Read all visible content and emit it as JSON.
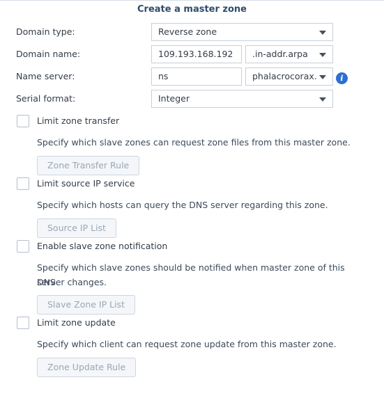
{
  "dialog": {
    "title": "Create a master zone"
  },
  "form": {
    "domain_type": {
      "label": "Domain type:",
      "value": "Reverse zone"
    },
    "domain_name": {
      "label": "Domain name:",
      "value": "109.193.168.192",
      "suffix": ".in-addr.arpa"
    },
    "name_server": {
      "label": "Name server:",
      "value": "ns",
      "domain": "phalacrocorax."
    },
    "serial_format": {
      "label": "Serial format:",
      "value": "Integer"
    }
  },
  "options": [
    {
      "label": "Limit zone transfer",
      "checked": false,
      "description": "Specify which slave zones can request zone files from this master zone.",
      "button": "Zone Transfer Rule"
    },
    {
      "label": "Limit source IP service",
      "checked": false,
      "description": "Specify which hosts can query the DNS server regarding this zone.",
      "button": "Source IP List"
    },
    {
      "label": "Enable slave zone notification",
      "checked": false,
      "description_line1": "Specify which slave zones should be notified when master zone of this DNS",
      "description_line2": "server changes.",
      "button": "Slave Zone IP List"
    },
    {
      "label": "Limit zone update",
      "checked": false,
      "description": "Specify which client can request zone update from this master zone.",
      "button": "Zone Update Rule"
    }
  ],
  "icons": {
    "info": "info-icon",
    "dropdown": "chevron-down-icon"
  },
  "colors": {
    "title": "#2f4a6d",
    "info_icon": "#2d6fd0",
    "disabled_text": "#9aa7b6"
  }
}
